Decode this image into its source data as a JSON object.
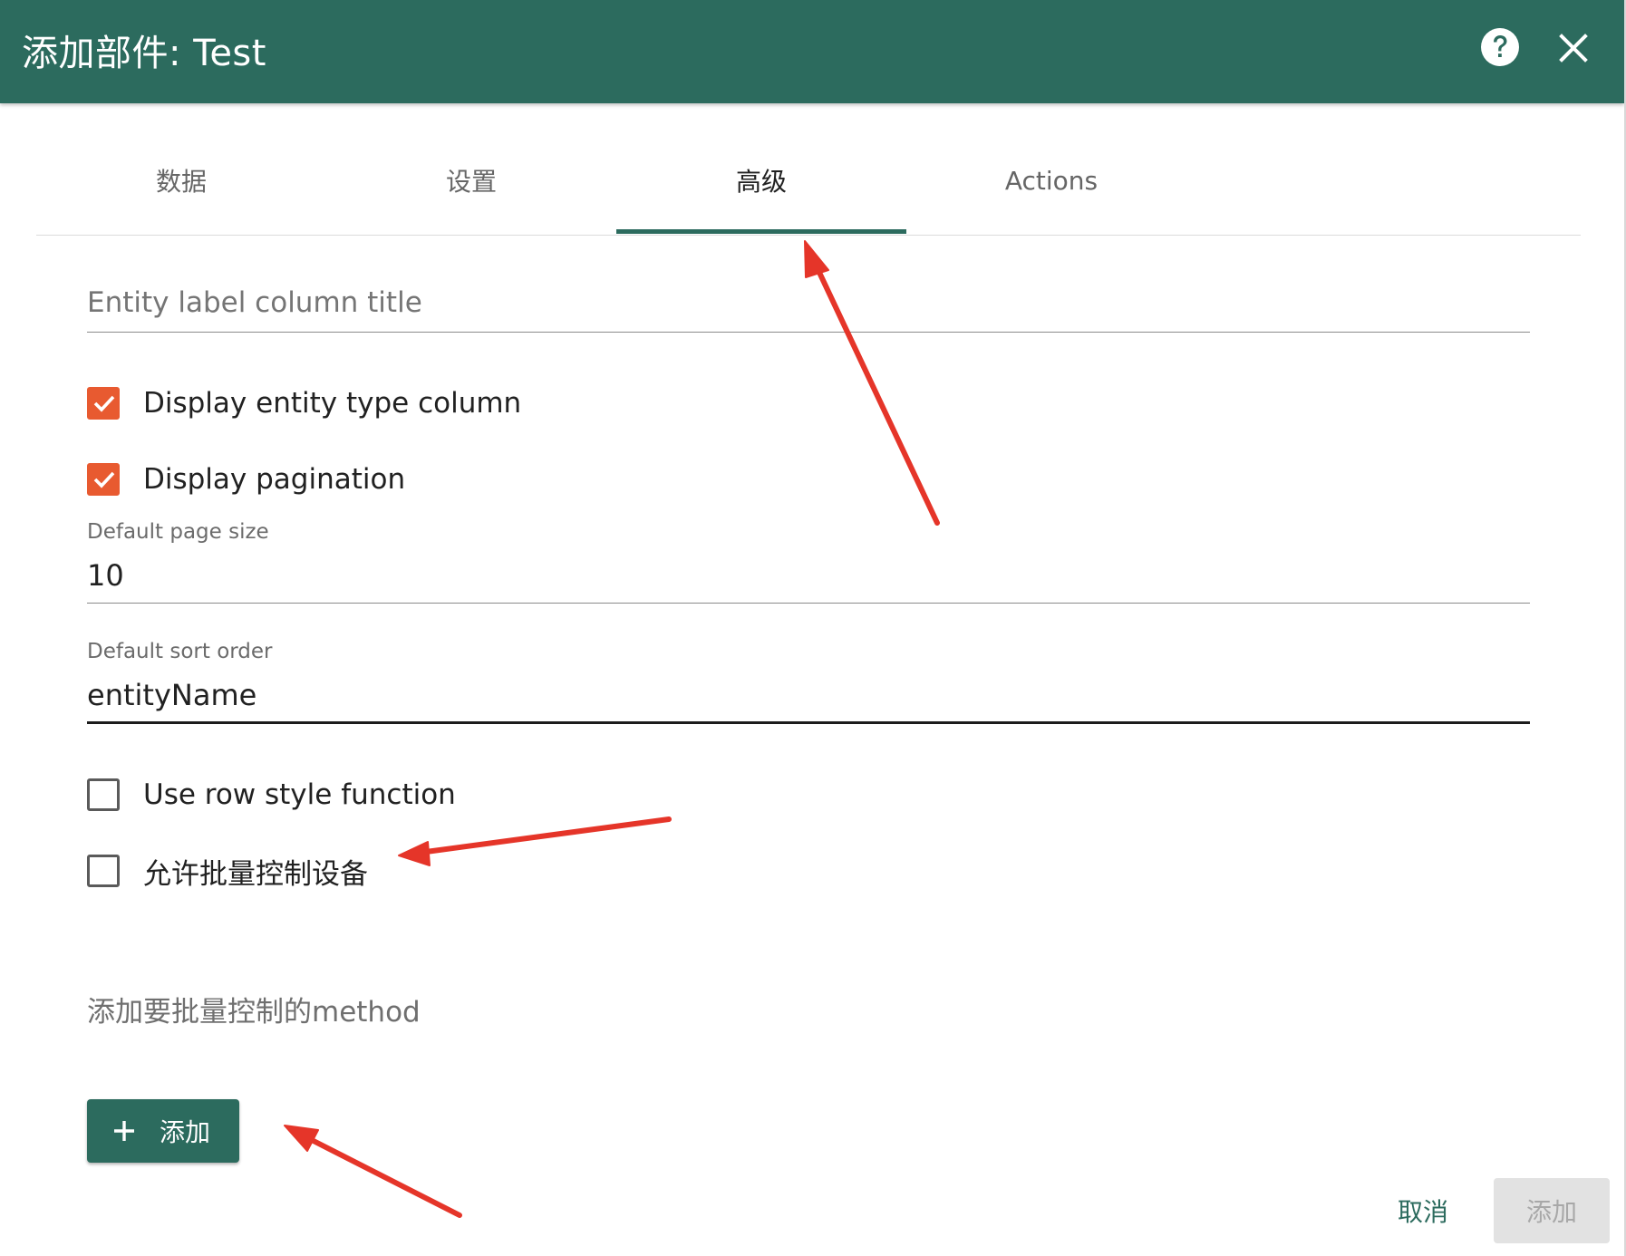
{
  "dialog": {
    "title": "添加部件: Test"
  },
  "header": {
    "help_icon": "help-circle-icon",
    "close_icon": "close-icon"
  },
  "tabs": [
    {
      "label": "数据",
      "active": false
    },
    {
      "label": "设置",
      "active": false
    },
    {
      "label": "高级",
      "active": true
    },
    {
      "label": "Actions",
      "active": false
    }
  ],
  "form": {
    "entity_label_title": {
      "placeholder": "Entity label column title",
      "value": ""
    },
    "display_entity_type": {
      "label": "Display entity type column",
      "checked": true
    },
    "display_pagination": {
      "label": "Display pagination",
      "checked": true
    },
    "page_size": {
      "label": "Default page size",
      "value": "10"
    },
    "sort_order": {
      "label": "Default sort order",
      "value": "entityName"
    },
    "row_style": {
      "label": "Use row style function",
      "checked": false
    },
    "batch_control": {
      "label": "允许批量控制设备",
      "checked": false
    },
    "method_section_label": "添加要批量控制的method",
    "add_button": {
      "label": "添加",
      "icon": "plus-icon"
    }
  },
  "footer": {
    "cancel_label": "取消",
    "submit_label": "添加"
  },
  "colors": {
    "primary": "#2c6b5e",
    "checkbox_checked": "#e85a30",
    "annotation_arrow": "#e53529",
    "disabled_bg": "#e2e2e2"
  }
}
